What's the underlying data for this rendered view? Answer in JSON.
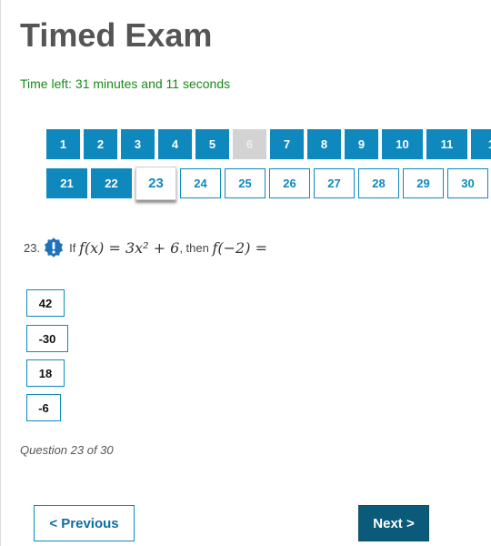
{
  "header": {
    "title": "Timed Exam",
    "timer": "Time left: 31 minutes and 11 seconds"
  },
  "nav": {
    "row1": [
      {
        "label": "1",
        "state": "answered"
      },
      {
        "label": "2",
        "state": "answered"
      },
      {
        "label": "3",
        "state": "answered"
      },
      {
        "label": "4",
        "state": "answered"
      },
      {
        "label": "5",
        "state": "answered"
      },
      {
        "label": "6",
        "state": "disabled"
      },
      {
        "label": "7",
        "state": "answered"
      },
      {
        "label": "8",
        "state": "answered"
      },
      {
        "label": "9",
        "state": "answered"
      },
      {
        "label": "10",
        "state": "answered"
      },
      {
        "label": "11",
        "state": "answered"
      },
      {
        "label": "1",
        "state": "answered"
      }
    ],
    "row2": [
      {
        "label": "21",
        "state": "answered"
      },
      {
        "label": "22",
        "state": "answered"
      },
      {
        "label": "23",
        "state": "current"
      },
      {
        "label": "24",
        "state": "unanswered"
      },
      {
        "label": "25",
        "state": "unanswered"
      },
      {
        "label": "26",
        "state": "unanswered"
      },
      {
        "label": "27",
        "state": "unanswered"
      },
      {
        "label": "28",
        "state": "unanswered"
      },
      {
        "label": "29",
        "state": "unanswered"
      },
      {
        "label": "30",
        "state": "unanswered"
      }
    ]
  },
  "question": {
    "number": "23.",
    "prefix": "If",
    "function_expr": "f(x) = 3x² + 6",
    "middle": ", then",
    "query_expr": "f(−2) =",
    "alert_icon": "exclamation-badge-icon"
  },
  "choices": [
    "42",
    "-30",
    "18",
    "-6"
  ],
  "progress_text": "Question 23 of 30",
  "footer": {
    "previous_label": "< Previous",
    "next_label": "Next >"
  },
  "colors": {
    "accent": "#0f89bd",
    "next_bg": "#0b5a7a",
    "timer": "#1a8a1a",
    "disabled": "#d3d3d3"
  }
}
